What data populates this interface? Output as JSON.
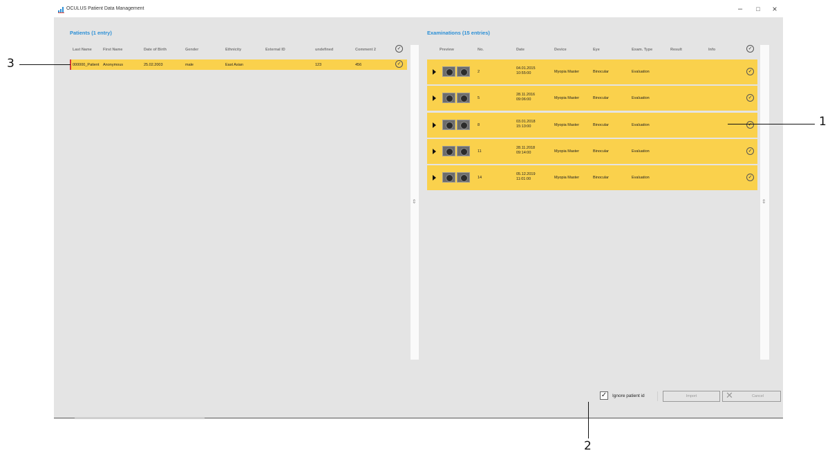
{
  "window": {
    "title": "OCULUS Patient Data Management",
    "minimize": "–",
    "maximize": "□",
    "close": "×"
  },
  "patients": {
    "title": "Patients (1 entry)",
    "columns": [
      "Last Name",
      "First Name",
      "Date of Birth",
      "Gender",
      "Ethnicity",
      "External ID",
      "undefined",
      "Comment 2"
    ],
    "rows": [
      {
        "last_name": "000000_Patient",
        "first_name": "Anonymous",
        "dob": "25.02.2003",
        "gender": "male",
        "ethnicity": "East Asian",
        "external_id": "",
        "undefined": "123",
        "comment2": "456",
        "selected": true
      }
    ]
  },
  "examinations": {
    "title": "Examinations (15 entries)",
    "columns": [
      "Preview",
      "No.",
      "Date",
      "Device",
      "Eye",
      "Exam. Type",
      "Result",
      "Info"
    ],
    "rows": [
      {
        "no": "2",
        "date": "04.01.2015",
        "time": "10:55:00",
        "device": "Myopia Master",
        "eye": "Binocular",
        "type": "Evaluation",
        "result": "",
        "info": "",
        "checked": true
      },
      {
        "no": "5",
        "date": "28.11.2016",
        "time": "09:06:00",
        "device": "Myopia Master",
        "eye": "Binocular",
        "type": "Evaluation",
        "result": "",
        "info": "",
        "checked": true
      },
      {
        "no": "8",
        "date": "03.01.2018",
        "time": "15:13:00",
        "device": "Myopia Master",
        "eye": "Binocular",
        "type": "Evaluation",
        "result": "",
        "info": "",
        "checked": true
      },
      {
        "no": "11",
        "date": "28.11.2018",
        "time": "09:14:00",
        "device": "Myopia Master",
        "eye": "Binocular",
        "type": "Evaluation",
        "result": "",
        "info": "",
        "checked": true
      },
      {
        "no": "14",
        "date": "05.12.2019",
        "time": "11:01:00",
        "device": "Myopia Master",
        "eye": "Binocular",
        "type": "Evaluation",
        "result": "",
        "info": "",
        "checked": true
      }
    ]
  },
  "footer": {
    "ignore_patient_id_label": "Ignore patient id",
    "ignore_patient_id_checked": true,
    "import_label": "Import",
    "cancel_label": "Cancel"
  },
  "callouts": {
    "one": "1",
    "two": "2",
    "three": "3"
  },
  "colors": {
    "accent": "#2b8fd6",
    "selected_row": "#fad14c",
    "panel_bg": "#e4e4e4"
  }
}
